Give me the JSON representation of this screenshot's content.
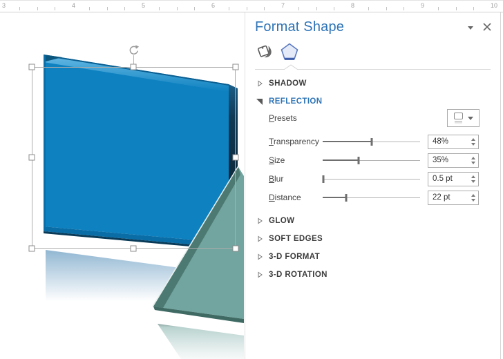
{
  "ruler": {
    "unit_labels": [
      "3",
      "4",
      "5",
      "6",
      "7",
      "8",
      "9",
      "10"
    ]
  },
  "panel": {
    "title": "Format Shape",
    "header_icons": {
      "options": "chevron-down-icon",
      "close": "close-icon"
    },
    "tabs": [
      {
        "icon": "paint-bucket-icon",
        "selected": false
      },
      {
        "icon": "pentagon-effects-icon",
        "selected": true
      }
    ],
    "sections": [
      {
        "label": "SHADOW",
        "expanded": false
      },
      {
        "label": "REFLECTION",
        "expanded": true
      },
      {
        "label": "GLOW",
        "expanded": false
      },
      {
        "label": "SOFT EDGES",
        "expanded": false
      },
      {
        "label": "3-D FORMAT",
        "expanded": false
      },
      {
        "label": "3-D ROTATION",
        "expanded": false
      }
    ],
    "reflection_controls": {
      "presets_label": "Presets",
      "sliders": [
        {
          "label": "Transparency",
          "value": "48%",
          "percent": 50
        },
        {
          "label": "Size",
          "value": "35%",
          "percent": 37
        },
        {
          "label": "Blur",
          "value": "0.5 pt",
          "percent": 1
        },
        {
          "label": "Distance",
          "value": "22 pt",
          "percent": 24
        }
      ]
    }
  },
  "colors": {
    "accent_blue": "#2E74B6",
    "blue_shape_fill": "#0E81C0",
    "teal_shape_fill": "#72A59F"
  }
}
